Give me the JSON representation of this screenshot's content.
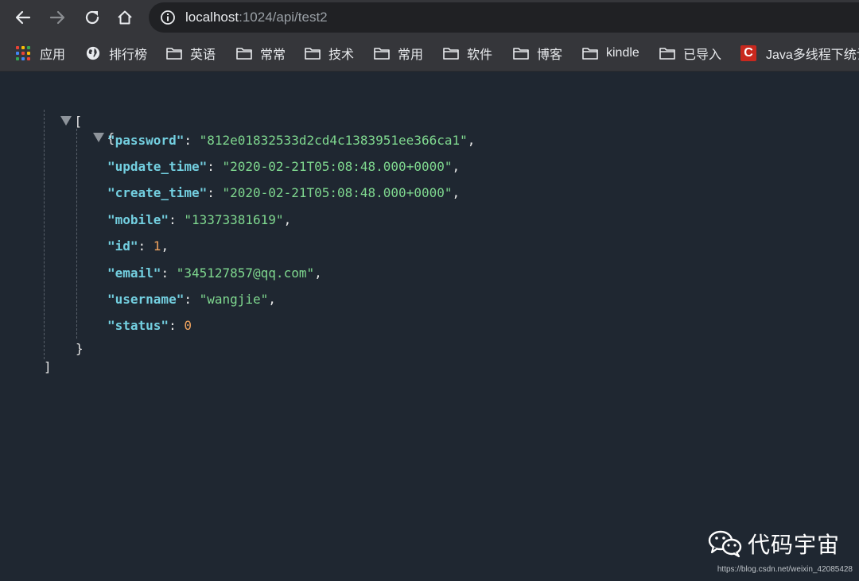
{
  "address": {
    "host": "localhost",
    "path": ":1024/api/test2"
  },
  "bookmarks": [
    {
      "label": "应用",
      "icon": "apps-grid-icon"
    },
    {
      "label": "排行榜",
      "icon": "globe-icon"
    },
    {
      "label": "英语",
      "icon": "folder-icon"
    },
    {
      "label": "常常",
      "icon": "folder-icon"
    },
    {
      "label": "技术",
      "icon": "folder-icon"
    },
    {
      "label": "常用",
      "icon": "folder-icon"
    },
    {
      "label": "软件",
      "icon": "folder-icon"
    },
    {
      "label": "博客",
      "icon": "folder-icon"
    },
    {
      "label": "kindle",
      "icon": "folder-icon"
    },
    {
      "label": "已导入",
      "icon": "folder-icon"
    },
    {
      "label": "Java多线程下统计",
      "icon": "csdn-c-icon"
    }
  ],
  "json": {
    "open_array": "[",
    "open_object": "{",
    "close_object": "}",
    "close_array": "]",
    "fields": [
      {
        "key": "\"password\"",
        "value": "\"812e01832533d2cd4c1383951ee366ca1\"",
        "type": "string",
        "comma": ","
      },
      {
        "key": "\"update_time\"",
        "value": "\"2020-02-21T05:08:48.000+0000\"",
        "type": "string",
        "comma": ","
      },
      {
        "key": "\"create_time\"",
        "value": "\"2020-02-21T05:08:48.000+0000\"",
        "type": "string",
        "comma": ","
      },
      {
        "key": "\"mobile\"",
        "value": "\"13373381619\"",
        "type": "string",
        "comma": ","
      },
      {
        "key": "\"id\"",
        "value": "1",
        "type": "number",
        "comma": ","
      },
      {
        "key": "\"email\"",
        "value": "\"345127857@qq.com\"",
        "type": "string",
        "comma": ","
      },
      {
        "key": "\"username\"",
        "value": "\"wangjie\"",
        "type": "string",
        "comma": ","
      },
      {
        "key": "\"status\"",
        "value": "0",
        "type": "number",
        "comma": ""
      }
    ]
  },
  "watermark": {
    "name": "代码宇宙",
    "url": "https://blog.csdn.net/weixin_42085428"
  },
  "colors": {
    "background": "#1f2731",
    "key": "#73cfe0",
    "string": "#7fd88f",
    "number": "#f0a35e"
  }
}
